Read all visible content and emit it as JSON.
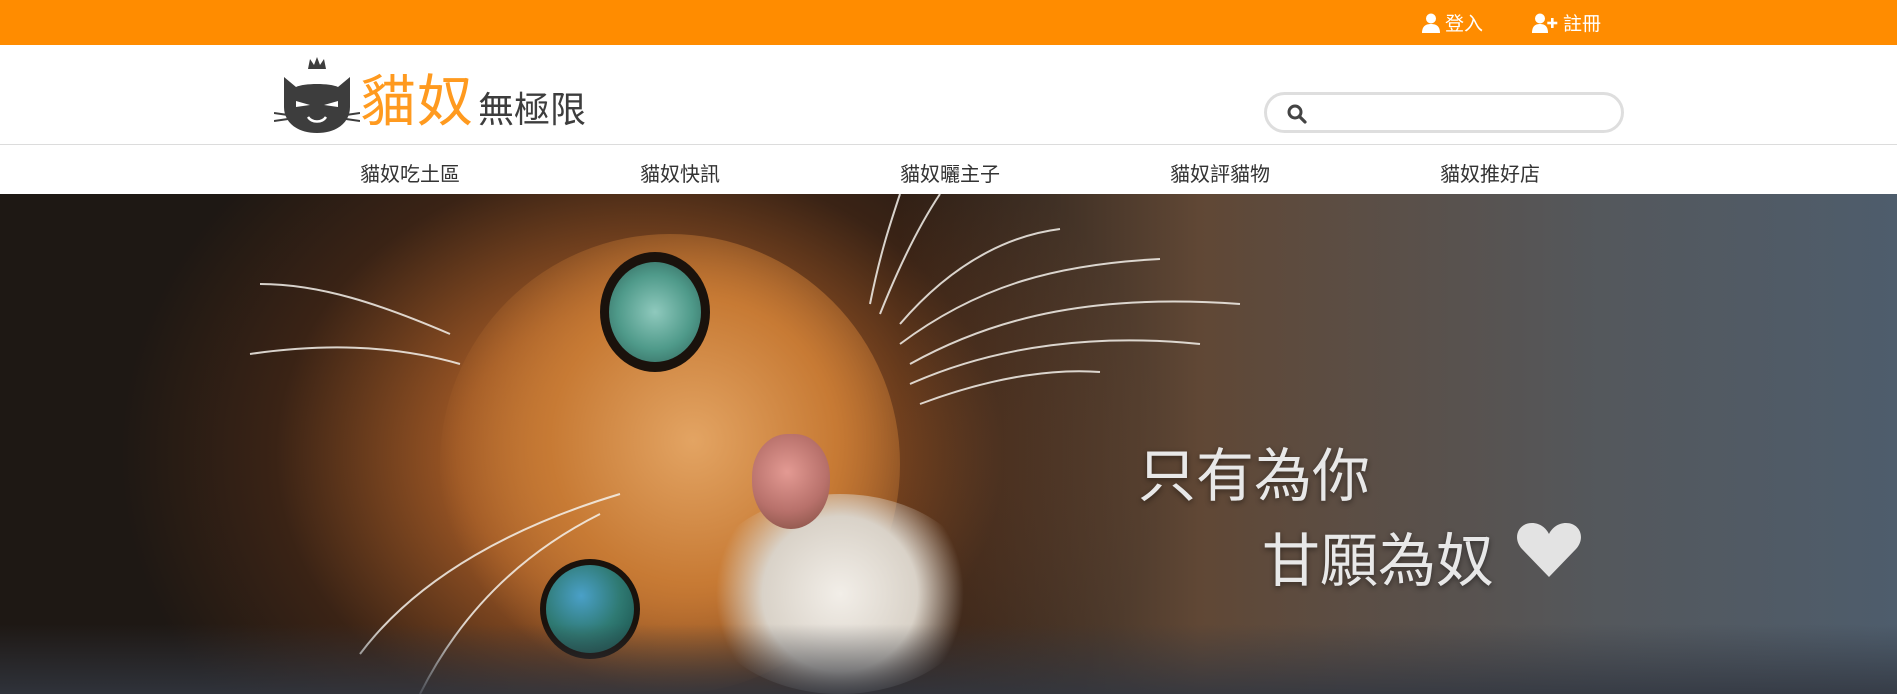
{
  "topbar": {
    "login_label": "登入",
    "register_label": "註冊",
    "background": "#ff8c00"
  },
  "header": {
    "logo_main": "貓奴",
    "logo_sub": "無極限",
    "search": {
      "value": "",
      "placeholder": ""
    }
  },
  "nav": {
    "items": [
      {
        "label": "貓奴吃土區"
      },
      {
        "label": "貓奴快訊"
      },
      {
        "label": "貓奴曬主子"
      },
      {
        "label": "貓奴評貓物"
      },
      {
        "label": "貓奴推好店"
      }
    ]
  },
  "hero": {
    "line1": "只有為你",
    "line2": "甘願為奴",
    "heart_icon": "heart-icon"
  },
  "colors": {
    "accent": "#ff8c00",
    "logo_orange": "#ff9a1f",
    "logo_dark": "#3d3d3d"
  }
}
